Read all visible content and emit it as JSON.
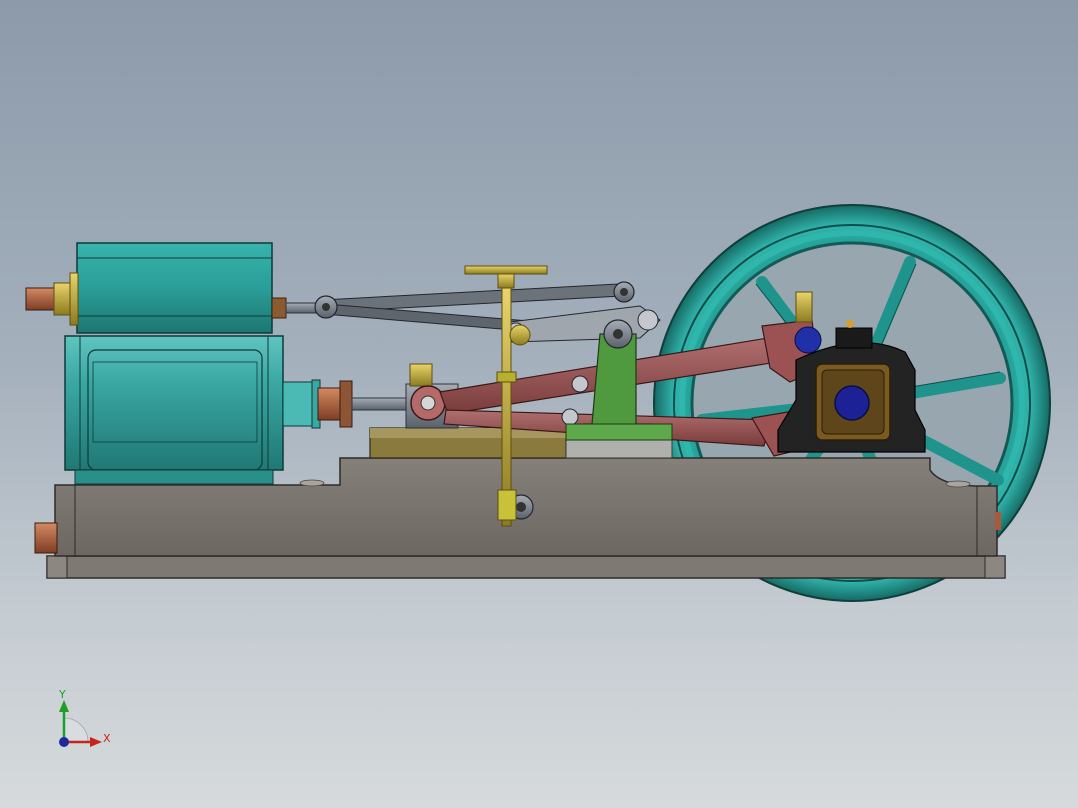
{
  "viewport": {
    "background_top": "#8c9aaa",
    "background_bottom": "#d6dadc"
  },
  "model": {
    "colors": {
      "cylinder": "#2a9e98",
      "cylinder_dark": "#1d6f6b",
      "flywheel": "#21a39a",
      "flywheel_dark": "#166e68",
      "base": "#7d7670",
      "base_dark": "#4e4844",
      "connecting_rod": "#8f4d4a",
      "bearing_block": "#222222",
      "crosshead_guide": "#4e8e3e",
      "governor": "#c8c23a",
      "copper": "#a85a3a",
      "steel": "#6f7680",
      "bearing_bore": "#1e2290"
    }
  },
  "triad": {
    "x_label": "X",
    "y_label": "Y",
    "x_color": "#c8241e",
    "y_color": "#1f9e2a",
    "z_color": "#1e2a9c"
  }
}
